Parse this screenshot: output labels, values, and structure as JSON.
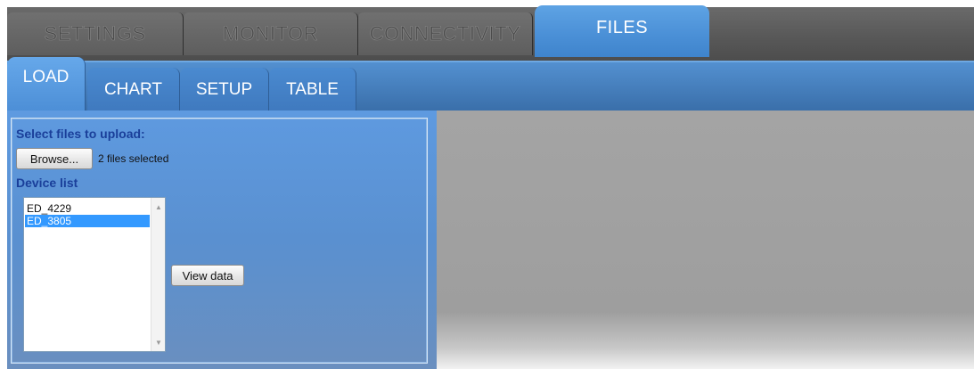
{
  "top_tabs": [
    {
      "label": "SETTINGS"
    },
    {
      "label": "MONITOR"
    },
    {
      "label": "CONNECTIVITY"
    },
    {
      "label": "FILES",
      "active": true
    }
  ],
  "sub_tabs": [
    {
      "label": "LOAD",
      "active": true
    },
    {
      "label": "CHART"
    },
    {
      "label": "SETUP"
    },
    {
      "label": "TABLE"
    }
  ],
  "load_panel": {
    "select_label": "Select files to upload:",
    "browse_label": "Browse...",
    "files_selected": "2 files selected",
    "device_list_label": "Device list",
    "devices": [
      {
        "name": "ED_4229",
        "selected": false
      },
      {
        "name": "ED_3805",
        "selected": true
      }
    ],
    "view_data_label": "View data"
  },
  "icons": {
    "scroll_up": "chevron-up-icon",
    "scroll_down": "chevron-down-icon"
  },
  "colors": {
    "active_tab": "#4a8fd6",
    "sub_bar": "#3a6faa",
    "label_text": "#1a3f9a",
    "selection": "#3399ff"
  }
}
